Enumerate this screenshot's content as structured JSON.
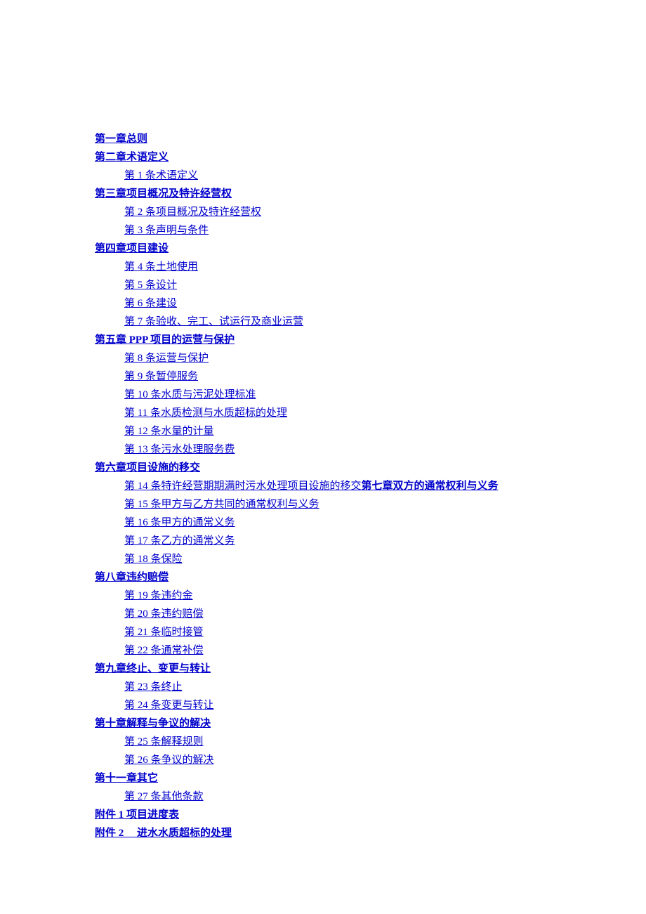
{
  "toc": {
    "ch1": "第一章总则",
    "ch2": "第二章术语定义",
    "ch2_items": {
      "a1": "第 1 条术语定义"
    },
    "ch3": "第三章项目概况及特许经营权",
    "ch3_items": {
      "a2": "第 2 条项目概况及特许经营权",
      "a3": "第 3 条声明与条件"
    },
    "ch4": "第四章项目建设",
    "ch4_items": {
      "a4": "第 4 条土地使用",
      "a5": "第 5 条设计",
      "a6": "第 6 条建设",
      "a7": "第 7 条验收、完工、试运行及商业运营"
    },
    "ch5": "第五章 PPP 项目的运营与保护",
    "ch5_items": {
      "a8": "第 8 条运营与保护",
      "a9": "第 9 条暂停服务",
      "a10": "第 10 条水质与污泥处理标准",
      "a11": "第 11 条水质检测与水质超标的处理",
      "a12": "第 12 条水量的计量",
      "a13": "第 13 条污水处理服务费"
    },
    "ch6": "第六章项目设施的移交",
    "ch6_items": {
      "a14a": "第 14 条特许经营期期满时污水处理项目设施的移交",
      "a14b": "第七章双方的通常权利与义务",
      "a15": "第 15 条甲方与乙方共同的通常权利与义务",
      "a16": "第 16 条甲方的通常义务",
      "a17": "第 17 条乙方的通常义务",
      "a18": "第 18 条保险"
    },
    "ch8": "第八章违约赔偿",
    "ch8_items": {
      "a19": "第 19 条违约金",
      "a20": "第 20 条违约赔偿",
      "a21": "第 21 条临时接管",
      "a22": "第 22 条通常补偿"
    },
    "ch9": "第九章终止、变更与转让",
    "ch9_items": {
      "a23": "第 23 条终止",
      "a24": "第 24 条变更与转让"
    },
    "ch10": "第十章解释与争议的解决",
    "ch10_items": {
      "a25": "第 25 条解释规则",
      "a26": "第 26 条争议的解决"
    },
    "ch11": "第十一章其它",
    "ch11_items": {
      "a27": "第 27 条其他条款"
    },
    "appendix1": "附件 1 项目进度表",
    "appendix2": "附件 2　 进水水质超标的处理"
  }
}
